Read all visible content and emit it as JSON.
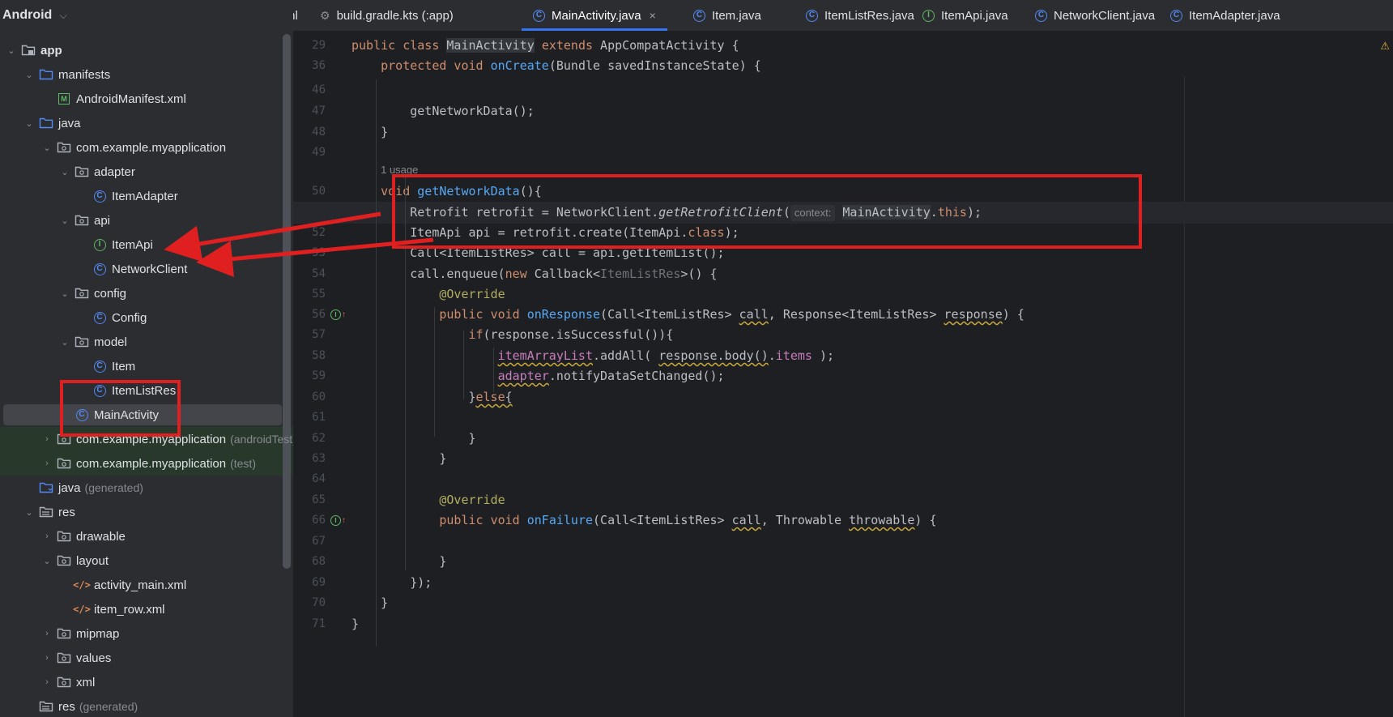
{
  "project_panel": {
    "title": "Android",
    "tree": [
      {
        "depth": 0,
        "arrow": "down",
        "icon": "module",
        "label": "app",
        "bold": true
      },
      {
        "depth": 1,
        "arrow": "down",
        "icon": "folder",
        "label": "manifests"
      },
      {
        "depth": 2,
        "arrow": "none",
        "icon": "manifest",
        "label": "AndroidManifest.xml"
      },
      {
        "depth": 1,
        "arrow": "down",
        "icon": "folder",
        "label": "java"
      },
      {
        "depth": 2,
        "arrow": "down",
        "icon": "package",
        "label": "com.example.myapplication"
      },
      {
        "depth": 3,
        "arrow": "down",
        "icon": "package",
        "label": "adapter"
      },
      {
        "depth": 4,
        "arrow": "none",
        "icon": "class",
        "label": "ItemAdapter"
      },
      {
        "depth": 3,
        "arrow": "down",
        "icon": "package",
        "label": "api"
      },
      {
        "depth": 4,
        "arrow": "none",
        "icon": "interface",
        "label": "ItemApi"
      },
      {
        "depth": 4,
        "arrow": "none",
        "icon": "class",
        "label": "NetworkClient"
      },
      {
        "depth": 3,
        "arrow": "down",
        "icon": "package",
        "label": "config"
      },
      {
        "depth": 4,
        "arrow": "none",
        "icon": "class",
        "label": "Config"
      },
      {
        "depth": 3,
        "arrow": "down",
        "icon": "package",
        "label": "model"
      },
      {
        "depth": 4,
        "arrow": "none",
        "icon": "class",
        "label": "Item"
      },
      {
        "depth": 4,
        "arrow": "none",
        "icon": "class",
        "label": "ItemListRes"
      },
      {
        "depth": 3,
        "arrow": "none",
        "icon": "class",
        "label": "MainActivity",
        "selected": true
      },
      {
        "depth": 2,
        "arrow": "right",
        "icon": "package",
        "label": "com.example.myapplication",
        "hint": "(androidTest)",
        "green": true
      },
      {
        "depth": 2,
        "arrow": "right",
        "icon": "package",
        "label": "com.example.myapplication",
        "hint": "(test)",
        "green": true
      },
      {
        "depth": 1,
        "arrow": "none",
        "icon": "generated-folder",
        "label": "java",
        "hint": "(generated)"
      },
      {
        "depth": 1,
        "arrow": "down",
        "icon": "res-folder",
        "label": "res"
      },
      {
        "depth": 2,
        "arrow": "right",
        "icon": "package",
        "label": "drawable"
      },
      {
        "depth": 2,
        "arrow": "down",
        "icon": "package",
        "label": "layout"
      },
      {
        "depth": 3,
        "arrow": "none",
        "icon": "xml",
        "label": "activity_main.xml"
      },
      {
        "depth": 3,
        "arrow": "none",
        "icon": "xml",
        "label": "item_row.xml"
      },
      {
        "depth": 2,
        "arrow": "right",
        "icon": "package",
        "label": "mipmap"
      },
      {
        "depth": 2,
        "arrow": "right",
        "icon": "package",
        "label": "values"
      },
      {
        "depth": 2,
        "arrow": "right",
        "icon": "package",
        "label": "xml"
      },
      {
        "depth": 1,
        "arrow": "none",
        "icon": "res-folder",
        "label": "res",
        "hint": "(generated)"
      }
    ]
  },
  "tabs": [
    {
      "label": "ml",
      "icon": "none"
    },
    {
      "label": "build.gradle.kts (:app)",
      "icon": "gradle"
    },
    {
      "label": "MainActivity.java",
      "icon": "class",
      "active": true,
      "close": "×"
    },
    {
      "label": "Item.java",
      "icon": "class"
    },
    {
      "label": "ItemListRes.java",
      "icon": "class"
    },
    {
      "label": "ItemApi.java",
      "icon": "interface"
    },
    {
      "label": "NetworkClient.java",
      "icon": "class"
    },
    {
      "label": "ItemAdapter.java",
      "icon": "class"
    }
  ],
  "editor": {
    "line_numbers": [
      "29",
      "36",
      "46",
      "47",
      "48",
      "49",
      "50",
      "51",
      "52",
      "53",
      "54",
      "55",
      "56",
      "57",
      "58",
      "59",
      "60",
      "61",
      "62",
      "63",
      "64",
      "65",
      "66",
      "67",
      "68",
      "69",
      "70",
      "71"
    ],
    "current_line": "51",
    "usage_hint": "1 usage",
    "context_hint": "context:",
    "code": {
      "l29": [
        "public",
        " ",
        "class",
        " ",
        "MainActivity",
        " ",
        "extends",
        " AppCompatActivity {"
      ],
      "l36": [
        "protected",
        " ",
        "void",
        " ",
        "onCreate",
        "(Bundle savedInstanceState) {"
      ],
      "l47": [
        "getNetworkData",
        "();"
      ],
      "l48": "}",
      "l50": [
        "void",
        " ",
        "getNetworkData",
        "(){"
      ],
      "l51": [
        "Retrofit retrofit = NetworkClient.",
        "getRetrofitClient",
        "(",
        "MainActivity",
        ".",
        "this",
        ");"
      ],
      "l52": [
        "ItemApi api = retrofit.create(ItemApi.",
        "class",
        ");"
      ],
      "l53": "Call<ItemListRes> call = api.getItemList();",
      "l54": [
        "call.enqueue(",
        "new",
        " Callback<",
        "ItemListRes",
        ">() {"
      ],
      "l55": "@Override",
      "l56": [
        "public",
        " ",
        "void",
        " ",
        "onResponse",
        "(Call<ItemListRes> ",
        "call",
        ", Response<ItemListRes> ",
        "response",
        ") {"
      ],
      "l57": [
        "if",
        "(response.isSuccessful()){"
      ],
      "l58": [
        "itemArrayList",
        ".addAll( ",
        "response.body()",
        ".",
        "items",
        " );"
      ],
      "l59": [
        "adapter",
        ".notifyDataSetChanged();"
      ],
      "l60": [
        "}",
        "else",
        "{"
      ],
      "l62": "}",
      "l63": "}",
      "l65": "@Override",
      "l66": [
        "public",
        " ",
        "void",
        " ",
        "onFailure",
        "(Call<ItemListRes> ",
        "call",
        ", Throwable ",
        "throwable",
        ") {"
      ],
      "l68": "}",
      "l69": "});",
      "l70": "}",
      "l71": "}"
    }
  },
  "colors": {
    "accent": "#3574f0",
    "annotation_red": "#e02020",
    "keyword": "#cf8e6d",
    "function": "#56a8f5",
    "field": "#c77dbb"
  }
}
